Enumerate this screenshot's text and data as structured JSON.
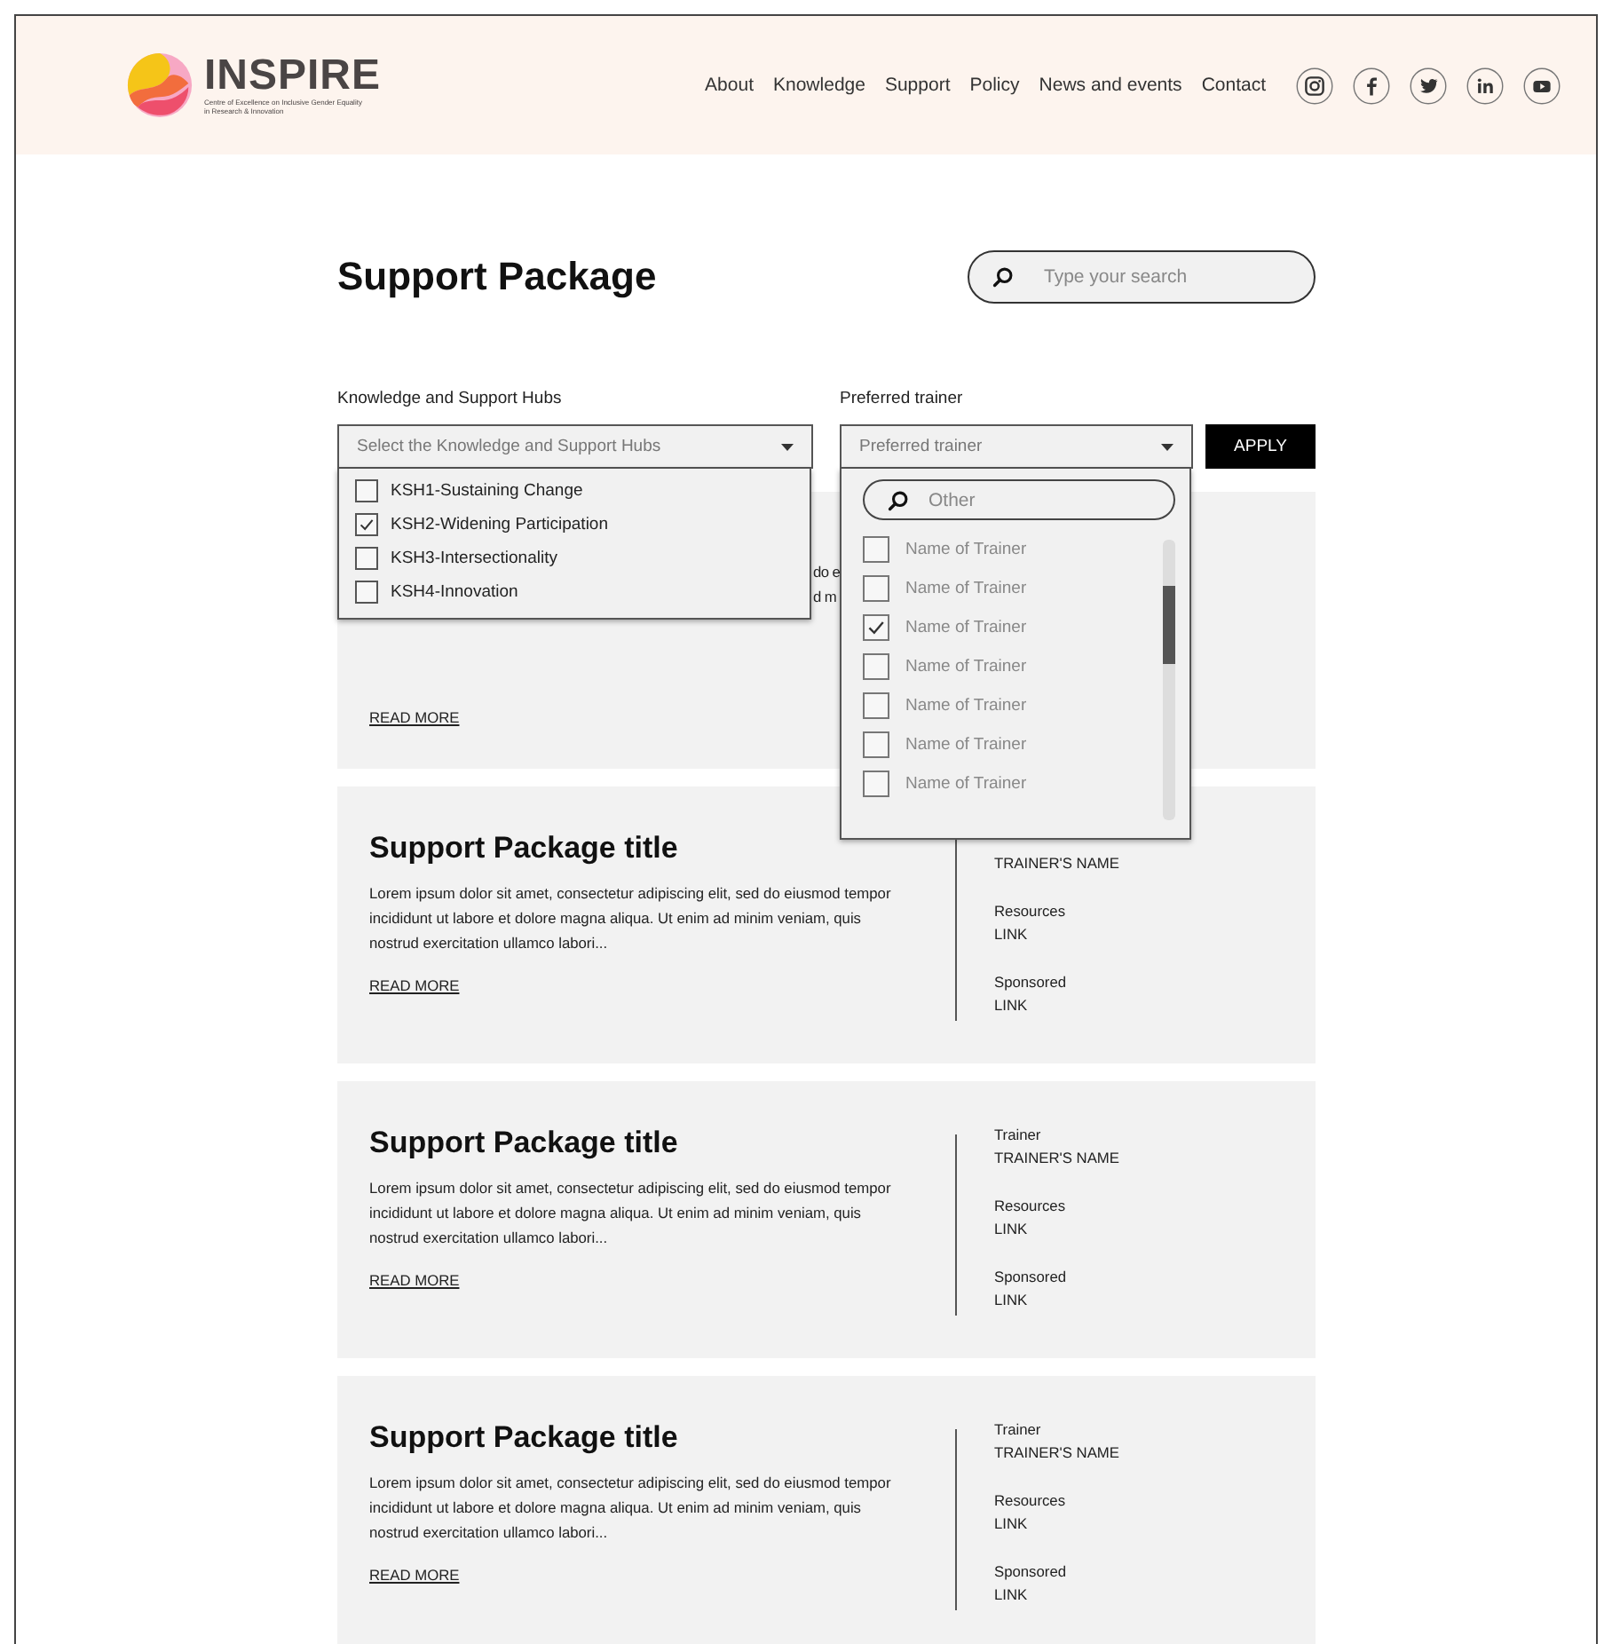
{
  "header": {
    "logo": {
      "name": "INSPIRE",
      "tagline": "Centre of Excellence on Inclusive Gender Equality in Research & Innovation"
    },
    "nav": [
      "About",
      "Knowledge",
      "Support",
      "Policy",
      "News and events",
      "Contact"
    ],
    "social": [
      {
        "kind": "instagram"
      },
      {
        "kind": "facebook"
      },
      {
        "kind": "twitter"
      },
      {
        "kind": "linkedin"
      },
      {
        "kind": "youtube"
      }
    ]
  },
  "page_title": "Support Package",
  "search": {
    "placeholder": "Type your search"
  },
  "filters": {
    "hubs": {
      "label": "Knowledge and Support Hubs",
      "placeholder": "Select the Knowledge and Support Hubs",
      "expanded": true,
      "options": [
        {
          "label": "KSH1-Sustaining Change",
          "checked": false
        },
        {
          "label": "KSH2-Widening Participation",
          "checked": true
        },
        {
          "label": "KSH3-Intersectionality",
          "checked": false
        },
        {
          "label": "KSH4-Innovation",
          "checked": false
        }
      ]
    },
    "trainer": {
      "label": "Preferred trainer",
      "placeholder": "Preferred trainer",
      "expanded": true,
      "search_placeholder": "Other",
      "options": [
        {
          "label": "Name of Trainer",
          "checked": false
        },
        {
          "label": "Name of Trainer",
          "checked": false
        },
        {
          "label": "Name of Trainer",
          "checked": true
        },
        {
          "label": "Name of Trainer",
          "checked": false
        },
        {
          "label": "Name of Trainer",
          "checked": false
        },
        {
          "label": "Name of Trainer",
          "checked": false
        },
        {
          "label": "Name of Trainer",
          "checked": false
        }
      ]
    },
    "apply": "APPLY"
  },
  "cards": [
    {
      "text_fragments": [
        "do e",
        "d m"
      ],
      "read_more": "READ MORE"
    },
    {
      "title": "Support Package title",
      "description": "Lorem ipsum dolor sit amet, consectetur adipiscing elit, sed do eiusmod tempor incididunt ut labore et dolore magna aliqua. Ut enim ad minim veniam, quis nostrud exercitation ullamco labori...",
      "read_more": "READ MORE",
      "trainer_name": "TRAINER'S NAME",
      "resources_label": "Resources",
      "resources_link": "LINK",
      "sponsored_label": "Sponsored",
      "sponsored_link": "LINK"
    },
    {
      "title": "Support Package title",
      "description": "Lorem ipsum dolor sit amet, consectetur adipiscing elit, sed do eiusmod tempor incididunt ut labore et dolore magna aliqua. Ut enim ad minim veniam, quis nostrud exercitation ullamco labori...",
      "read_more": "READ MORE",
      "trainer_label": "Trainer",
      "trainer_name": "TRAINER'S NAME",
      "resources_label": "Resources",
      "resources_link": "LINK",
      "sponsored_label": "Sponsored",
      "sponsored_link": "LINK"
    },
    {
      "title": "Support Package title",
      "description": "Lorem ipsum dolor sit amet, consectetur adipiscing elit, sed do eiusmod tempor incididunt ut labore et dolore magna aliqua. Ut enim ad minim veniam, quis nostrud exercitation ullamco labori...",
      "read_more": "READ MORE",
      "trainer_label": "Trainer",
      "trainer_name": "TRAINER'S NAME",
      "resources_label": "Resources",
      "resources_link": "LINK",
      "sponsored_label": "Sponsored",
      "sponsored_link": "LINK"
    }
  ]
}
